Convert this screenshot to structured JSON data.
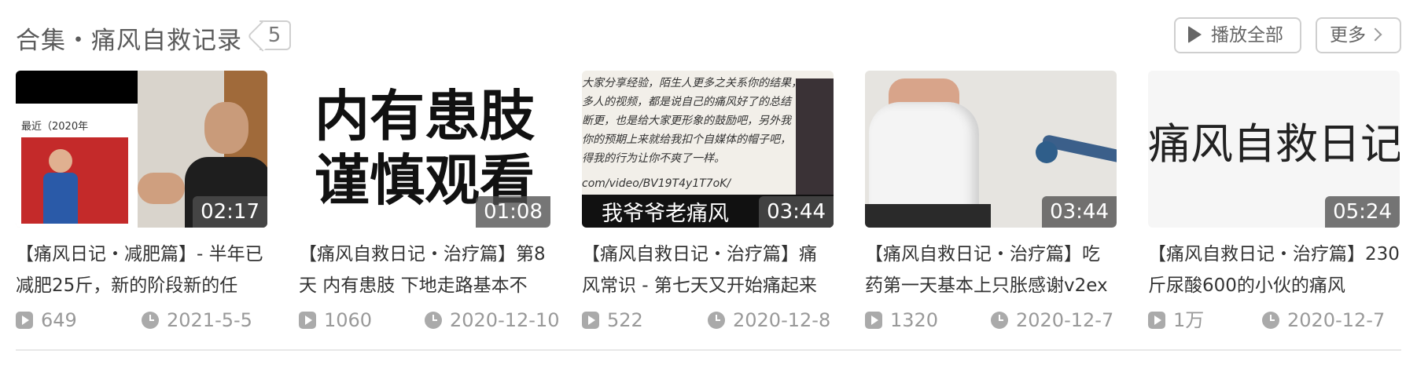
{
  "header": {
    "title": "合集・痛风自救记录",
    "count": "5",
    "play_all_label": "播放全部",
    "more_label": "更多"
  },
  "videos": [
    {
      "duration": "02:17",
      "title": "【痛风日记・减肥篇】- 半年已减肥25斤，新的阶段新的任",
      "views": "649",
      "date": "2021-5-5",
      "thumb_text": "最近（2020年"
    },
    {
      "duration": "01:08",
      "title": "【痛风自救日记・治疗篇】第8天 内有患肢 下地走路基本不",
      "views": "1060",
      "date": "2020-12-10",
      "thumb_text": [
        "内有患肢",
        "谨慎观看"
      ]
    },
    {
      "duration": "03:44",
      "title": "【痛风自救日记・治疗篇】痛风常识 - 第七天又开始痛起来",
      "views": "522",
      "date": "2020-12-8",
      "thumb_text": [
        "大家分享经验，陌生人更多之关系你的结果，",
        "多人的视频，都是说自己的痛风好了的总结",
        "断更，也是给大家更形象的鼓励吧，另外我",
        "你的预期上来就给我扣个自媒体的帽子吧，",
        "得我的行为让你不爽了一样。",
        "com/video/BV19T4y1T7oK/",
        "我爷爷老痛风"
      ]
    },
    {
      "duration": "03:44",
      "title": "【痛风自救日记・治疗篇】吃药第一天基本上只胀感谢v2ex",
      "views": "1320",
      "date": "2020-12-7"
    },
    {
      "duration": "05:24",
      "title": "【痛风自救日记・治疗篇】230斤尿酸600的小伙的痛风",
      "views": "1万",
      "date": "2020-12-7",
      "thumb_text": "痛风自救日记"
    }
  ]
}
